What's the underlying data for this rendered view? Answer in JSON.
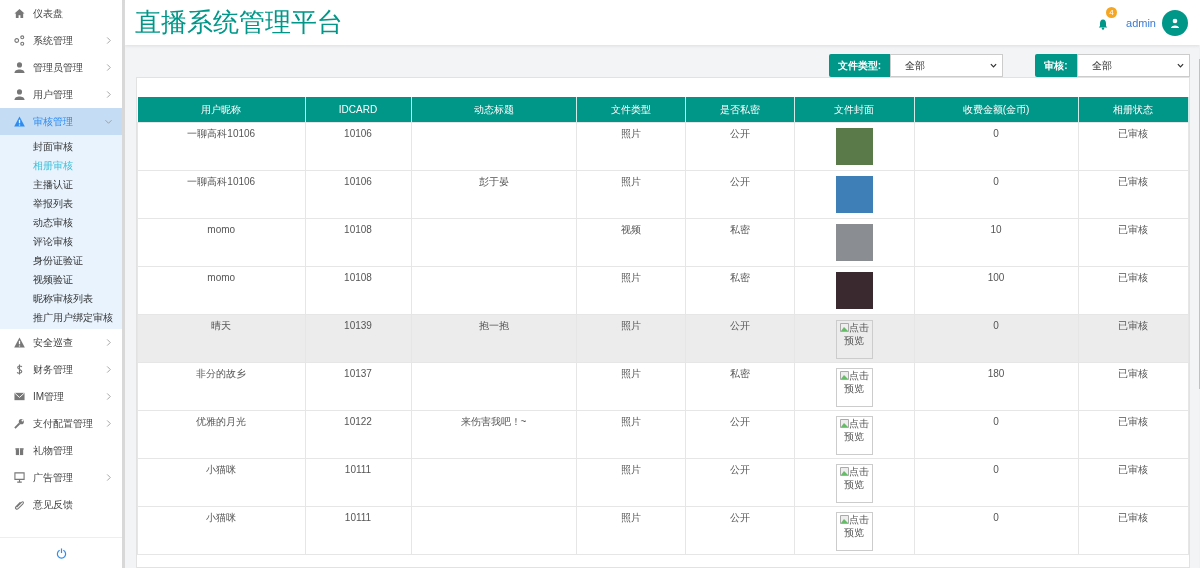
{
  "sidebar": {
    "items": [
      {
        "label": "仪表盘",
        "has_arrow": false,
        "expanded": false
      },
      {
        "label": "系统管理",
        "has_arrow": true,
        "expanded": false
      },
      {
        "label": "管理员管理",
        "has_arrow": true,
        "expanded": false
      },
      {
        "label": "用户管理",
        "has_arrow": true,
        "expanded": false
      },
      {
        "label": "审核管理",
        "has_arrow": true,
        "expanded": true,
        "children": [
          {
            "label": "封面审核",
            "selected": false
          },
          {
            "label": "相册审核",
            "selected": true
          },
          {
            "label": "主播认证",
            "selected": false
          },
          {
            "label": "举报列表",
            "selected": false
          },
          {
            "label": "动态审核",
            "selected": false
          },
          {
            "label": "评论审核",
            "selected": false
          },
          {
            "label": "身份证验证",
            "selected": false
          },
          {
            "label": "视频验证",
            "selected": false
          },
          {
            "label": "昵称审核列表",
            "selected": false
          },
          {
            "label": "推广用户绑定审核",
            "selected": false
          }
        ]
      },
      {
        "label": "安全巡查",
        "has_arrow": true,
        "expanded": false
      },
      {
        "label": "财务管理",
        "has_arrow": true,
        "expanded": false
      },
      {
        "label": "IM管理",
        "has_arrow": true,
        "expanded": false
      },
      {
        "label": "支付配置管理",
        "has_arrow": true,
        "expanded": false
      },
      {
        "label": "礼物管理",
        "has_arrow": false,
        "expanded": false
      },
      {
        "label": "广告管理",
        "has_arrow": true,
        "expanded": false
      },
      {
        "label": "意见反馈",
        "has_arrow": false,
        "expanded": false
      }
    ]
  },
  "header": {
    "title": "直播系统管理平台",
    "notifications": "4",
    "user": "admin"
  },
  "filters": [
    {
      "label": "文件类型:",
      "value": "全部"
    },
    {
      "label": "审核:",
      "value": "全部"
    }
  ],
  "table": {
    "columns": [
      "用户昵称",
      "IDCARD",
      "动态标题",
      "文件类型",
      "是否私密",
      "文件封面",
      "收费金额(金币)",
      "相册状态"
    ],
    "rows": [
      {
        "nickname": "一聊高科10106",
        "idcard": "10106",
        "title": "",
        "type": "照片",
        "privacy": "公开",
        "cover": {
          "kind": "photo",
          "color": "#5a7a4a"
        },
        "fee": "0",
        "status": "已审核",
        "highlighted": false
      },
      {
        "nickname": "一聊高科10106",
        "idcard": "10106",
        "title": "彭于晏",
        "type": "照片",
        "privacy": "公开",
        "cover": {
          "kind": "photo",
          "color": "#3f7fb8"
        },
        "fee": "0",
        "status": "已审核",
        "highlighted": false
      },
      {
        "nickname": "momo",
        "idcard": "10108",
        "title": "",
        "type": "视频",
        "privacy": "私密",
        "cover": {
          "kind": "photo",
          "color": "#8a8d92"
        },
        "fee": "10",
        "status": "已审核",
        "highlighted": false
      },
      {
        "nickname": "momo",
        "idcard": "10108",
        "title": "",
        "type": "照片",
        "privacy": "私密",
        "cover": {
          "kind": "photo",
          "color": "#3a2a30"
        },
        "fee": "100",
        "status": "已审核",
        "highlighted": false
      },
      {
        "nickname": "晴天",
        "idcard": "10139",
        "title": "抱一抱",
        "type": "照片",
        "privacy": "公开",
        "cover": {
          "kind": "broken",
          "alt": "点击预览"
        },
        "fee": "0",
        "status": "已审核",
        "highlighted": true
      },
      {
        "nickname": "非分的故乡",
        "idcard": "10137",
        "title": "",
        "type": "照片",
        "privacy": "私密",
        "cover": {
          "kind": "broken",
          "alt": "点击预览"
        },
        "fee": "180",
        "status": "已审核",
        "highlighted": false
      },
      {
        "nickname": "优雅的月光",
        "idcard": "10122",
        "title": "来伤害我吧！~",
        "type": "照片",
        "privacy": "公开",
        "cover": {
          "kind": "broken",
          "alt": "点击预览"
        },
        "fee": "0",
        "status": "已审核",
        "highlighted": false
      },
      {
        "nickname": "小猫咪",
        "idcard": "10111",
        "title": "",
        "type": "照片",
        "privacy": "公开",
        "cover": {
          "kind": "broken",
          "alt": "点击预览"
        },
        "fee": "0",
        "status": "已审核",
        "highlighted": false
      },
      {
        "nickname": "小猫咪",
        "idcard": "10111",
        "title": "",
        "type": "照片",
        "privacy": "公开",
        "cover": {
          "kind": "broken",
          "alt": "点击预览"
        },
        "fee": "0",
        "status": "已审核",
        "highlighted": false
      }
    ]
  }
}
